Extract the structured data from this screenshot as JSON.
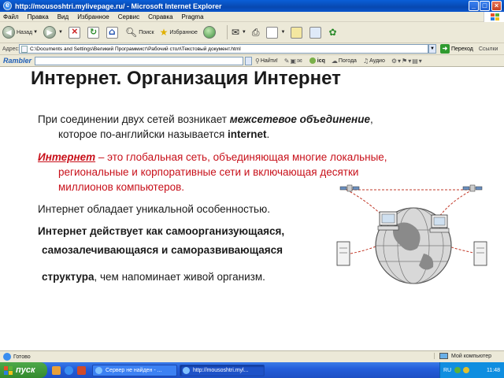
{
  "window": {
    "title": "http://mousoshtri.mylivepage.ru/ - Microsoft Internet Explorer"
  },
  "menu": [
    "Файл",
    "Правка",
    "Вид",
    "Избранное",
    "Сервис",
    "Справка",
    "Pragma"
  ],
  "toolbar": {
    "back_label": "Назад",
    "search_label": "Поиск",
    "favorites_label": "Избранное"
  },
  "address": {
    "label": "Адрес:",
    "value": "C:\\Documents and Settings\\Великий Программист\\Рабочий стол\\Текстовый документ.html",
    "go_label": "Переход",
    "links_label": "Ссылки"
  },
  "rambler": {
    "logo": "Rambler",
    "find_label": "Найти!",
    "icq_label": "icq",
    "weather_label": "Погода",
    "audio_label": "Аудио"
  },
  "slide": {
    "title": "Интернет. Организация Интернет",
    "p1": {
      "a": "При соединении двух сетей возникает ",
      "b": "межсетевое объединение",
      "c": ",",
      "d": "которое по-английски называется ",
      "e": "internet",
      "f": "."
    },
    "p2": {
      "term": "Интернет",
      "a": " – это глобальная сеть, объединяющая многие локальные,",
      "b": "региональные и корпоративные сети и включающая десятки",
      "c": "миллионов компьютеров."
    },
    "p3": "Интернет обладает уникальной особенностью.",
    "p4": "Интернет действует как самоорганизующаяся,",
    "p5": "самозалечивающаяся и саморазвивающаяся",
    "p6": {
      "a": "структура",
      "b": ", чем напоминает живой организм."
    }
  },
  "status": {
    "text": "Готово",
    "zone": "Мой компьютер"
  },
  "taskbar": {
    "start_label": "пуск",
    "tasks": [
      "Сервер не найден - ...",
      "http://mousoshtri.myl..."
    ],
    "lang": "RU",
    "clock": "11:48"
  }
}
